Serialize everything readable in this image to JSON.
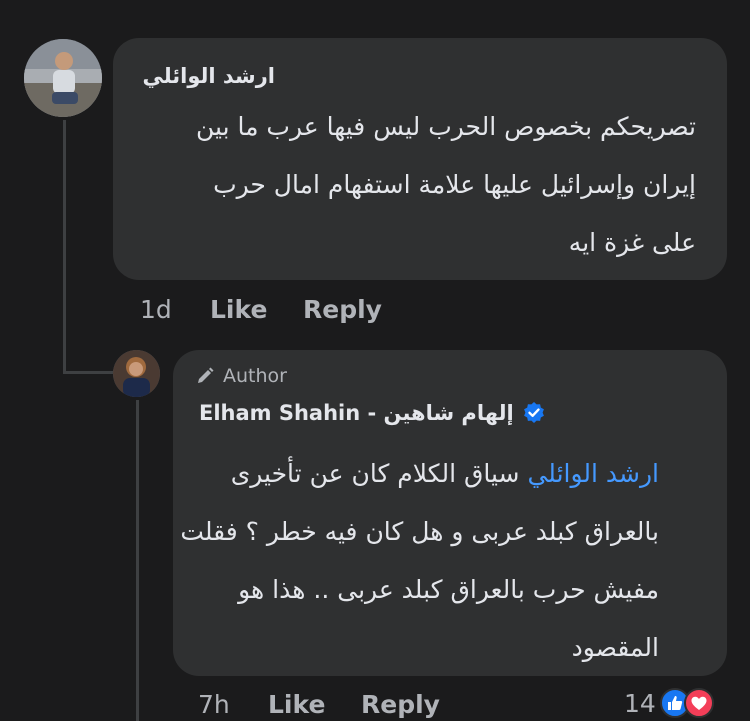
{
  "comment": {
    "author": "ارشد الوائلي",
    "lines": [
      "تصريحكم بخصوص الحرب ليس فيها عرب ما بين",
      "إيران وإسرائيل عليها علامة استفهام امال حرب",
      "على غزة ايه"
    ],
    "time": "1d",
    "like_label": "Like",
    "reply_label": "Reply"
  },
  "reply": {
    "badge_label": "Author",
    "author": "Elham Shahin - إلهام شاهين",
    "mention": "ارشد الوائلي",
    "first_line_rest": "سياق الكلام  كان عن تأخيرى",
    "lines": [
      "بالعراق كبلد عربى  و هل كان فيه خطر ؟ فقلت",
      "مفيش حرب بالعراق كبلد عربى .. هذا هو",
      "المقصود"
    ],
    "time": "7h",
    "like_label": "Like",
    "reply_label": "Reply",
    "reaction_count": "14"
  },
  "icons": {
    "verified": "verified-badge-icon",
    "pencil": "pencil-icon",
    "like_reaction": "like-reaction-icon",
    "love_reaction": "love-reaction-icon"
  },
  "colors": {
    "background": "#1b1b1c",
    "bubble": "#2f3031",
    "mention": "#4599ff",
    "verified": "#1877f2",
    "like": "#1877f2",
    "love": "#f33e58"
  }
}
